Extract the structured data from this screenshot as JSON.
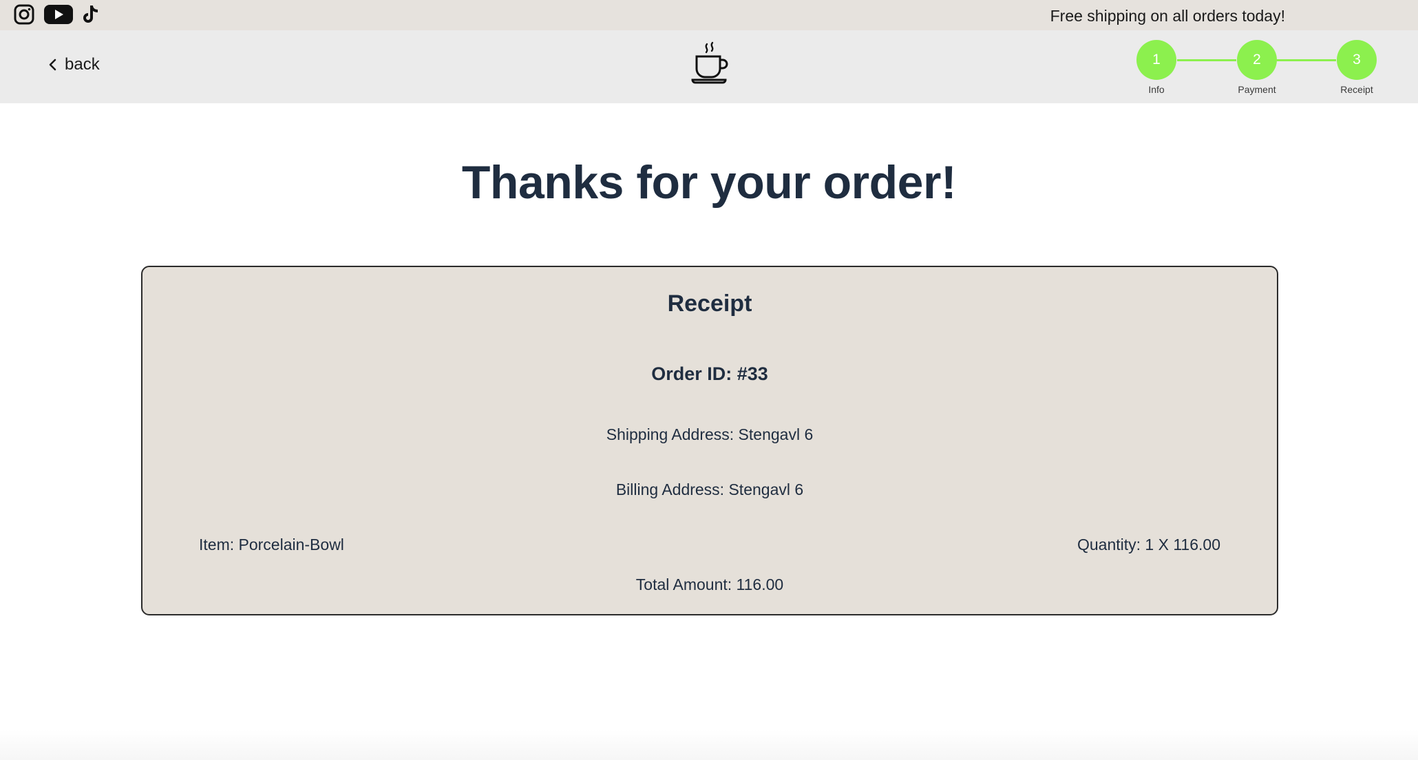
{
  "topbar": {
    "social_icons": [
      "instagram-icon",
      "youtube-icon",
      "tiktok-icon"
    ],
    "announcement": "Free shipping on all orders today!"
  },
  "header": {
    "back_label": "back",
    "logo_icon": "coffee-cup-icon",
    "steps": [
      {
        "number": "1",
        "label": "Info"
      },
      {
        "number": "2",
        "label": "Payment"
      },
      {
        "number": "3",
        "label": "Receipt"
      }
    ],
    "step_color": "#8cf04e"
  },
  "main": {
    "title": "Thanks for your order!",
    "receipt": {
      "heading": "Receipt",
      "order_id": "Order ID: #33",
      "shipping_address": "Shipping Address: Stengavl 6",
      "billing_address": "Billing Address: Stengavl 6",
      "item": "Item: Porcelain-Bowl",
      "quantity": "Quantity: 1 X 116.00",
      "total": "Total Amount: 116.00"
    }
  },
  "colors": {
    "topbar_bg": "#e6e2dd",
    "header_bg": "#ebebeb",
    "receipt_bg": "#e5e0d9",
    "text_dark": "#1f2d40"
  }
}
